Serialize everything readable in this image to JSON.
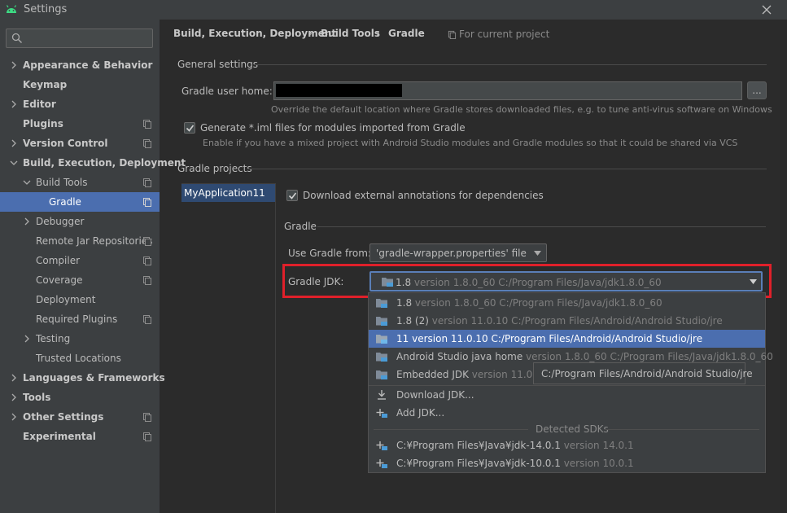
{
  "window": {
    "title": "Settings"
  },
  "search": {
    "placeholder": ""
  },
  "sidebar": {
    "items": [
      {
        "label": "Appearance & Behavior"
      },
      {
        "label": "Keymap"
      },
      {
        "label": "Editor"
      },
      {
        "label": "Plugins"
      },
      {
        "label": "Version Control"
      },
      {
        "label": "Build, Execution, Deployment"
      },
      {
        "label": "Build Tools"
      },
      {
        "label": "Gradle"
      },
      {
        "label": "Debugger"
      },
      {
        "label": "Remote Jar Repositories"
      },
      {
        "label": "Compiler"
      },
      {
        "label": "Coverage"
      },
      {
        "label": "Deployment"
      },
      {
        "label": "Required Plugins"
      },
      {
        "label": "Testing"
      },
      {
        "label": "Trusted Locations"
      },
      {
        "label": "Languages & Frameworks"
      },
      {
        "label": "Tools"
      },
      {
        "label": "Other Settings"
      },
      {
        "label": "Experimental"
      }
    ]
  },
  "breadcrumb": {
    "items": [
      "Build, Execution, Deployment",
      "Build Tools",
      "Gradle"
    ],
    "separator": "›",
    "hint": "For current project"
  },
  "general": {
    "title": "General settings",
    "user_home_label": "Gradle user home:",
    "user_home_value": "",
    "browse_label": "...",
    "user_home_hint": "Override the default location where Gradle stores downloaded files, e.g. to tune anti-virus software on Windows",
    "iml_label": "Generate *.iml files for modules imported from Gradle",
    "iml_checked": true,
    "iml_hint": "Enable if you have a mixed project with Android Studio modules and Gradle modules so that it could be shared via VCS"
  },
  "projects": {
    "title": "Gradle projects",
    "list": [
      "MyApplication11"
    ],
    "download_annotations_label": "Download external annotations for dependencies",
    "download_annotations_checked": true,
    "gradle_section_title": "Gradle",
    "use_gradle_from_label": "Use Gradle from:",
    "use_gradle_from_value": "'gradle-wrapper.properties' file",
    "gradle_jdk_label": "Gradle JDK:",
    "gradle_jdk_selected_name": "1.8",
    "gradle_jdk_selected_detail": "version 1.8.0_60 C:/Program Files/Java/jdk1.8.0_60"
  },
  "jdk_popup": {
    "items": [
      {
        "name": "1.8",
        "detail": "version 1.8.0_60 C:/Program Files/Java/jdk1.8.0_60",
        "icon": "folder-icon",
        "selected": false
      },
      {
        "name": "1.8 (2)",
        "detail": "version 11.0.10 C:/Program Files/Android/Android Studio/jre",
        "icon": "folder-icon",
        "selected": false
      },
      {
        "name": "11",
        "detail": "version 11.0.10 C:/Program Files/Android/Android Studio/jre",
        "icon": "folder-icon",
        "selected": true
      },
      {
        "name": "Android Studio java home",
        "detail": "version 1.8.0_60 C:/Program Files/Java/jdk1.8.0_60",
        "icon": "folder-icon",
        "selected": false
      },
      {
        "name": "Embedded JDK",
        "detail": "version 11.0.10 C",
        "icon": "folder-icon",
        "selected": false
      }
    ],
    "actions": [
      {
        "label": "Download JDK...",
        "icon": "download-icon"
      },
      {
        "label": "Add JDK...",
        "icon": "add-jdk-icon"
      }
    ],
    "detected_title": "Detected SDKs",
    "detected": [
      {
        "name": "C:¥Program Files¥Java¥jdk-14.0.1",
        "detail": "version 14.0.1",
        "icon": "add-jdk-icon"
      },
      {
        "name": "C:¥Program Files¥Java¥jdk-10.0.1",
        "detail": "version 10.0.1",
        "icon": "add-jdk-icon"
      }
    ]
  },
  "tooltip": {
    "text": "C:/Program Files/Android/Android Studio/jre"
  },
  "colors": {
    "accent": "#4b6eaf",
    "highlight_box": "#e0202a",
    "background": "#2b2b2b",
    "sidebar": "#3c3f41"
  }
}
